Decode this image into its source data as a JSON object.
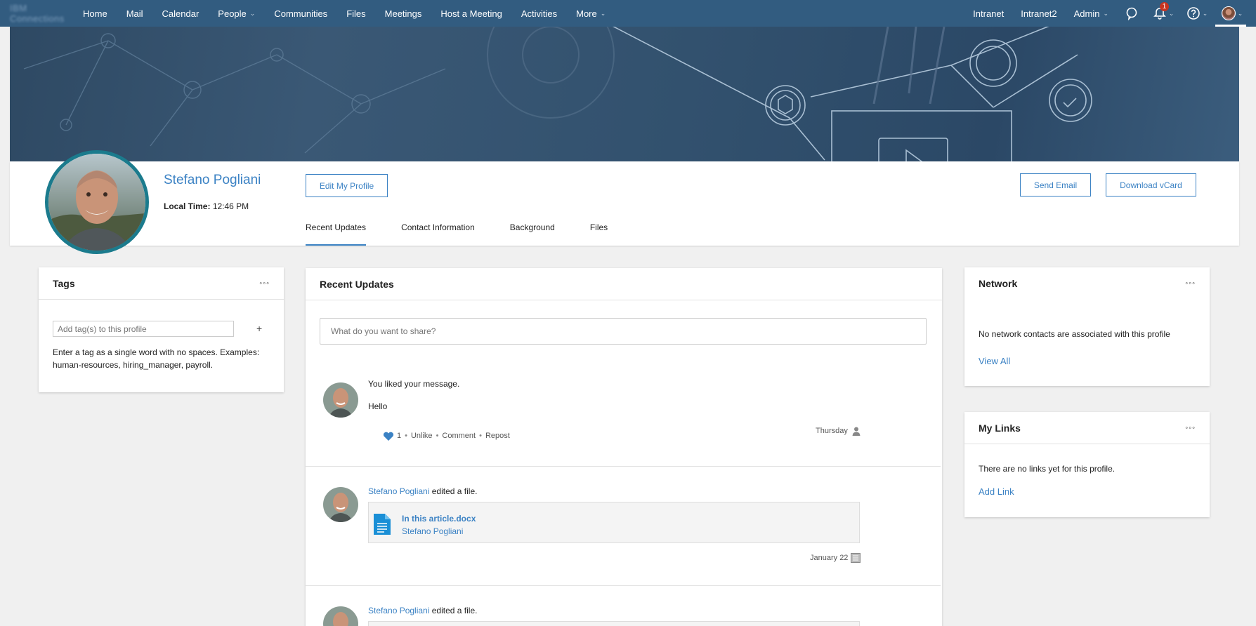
{
  "nav": {
    "brand": "IBM Connections",
    "items": [
      "Home",
      "Mail",
      "Calendar",
      "People",
      "Communities",
      "Files",
      "Meetings",
      "Host a Meeting",
      "Activities",
      "More"
    ],
    "right_items": [
      "Intranet",
      "Intranet2",
      "Admin"
    ],
    "notification_count": "1"
  },
  "profile": {
    "name": "Stefano Pogliani",
    "local_time_label": "Local Time:",
    "local_time": "12:46 PM",
    "edit_button": "Edit My Profile",
    "send_email": "Send Email",
    "download_vcard": "Download vCard",
    "tabs": [
      "Recent Updates",
      "Contact Information",
      "Background",
      "Files"
    ]
  },
  "tags_card": {
    "title": "Tags",
    "placeholder": "Add tag(s) to this profile",
    "add": "+",
    "help": "Enter a tag as a single word with no spaces. Examples: human-resources, hiring_manager, payroll."
  },
  "updates": {
    "title": "Recent Updates",
    "share_placeholder": "What do you want to share?",
    "entries": [
      {
        "text": "You liked your message.",
        "message": "Hello",
        "likes": "1",
        "actions": [
          "Unlike",
          "Comment",
          "Repost"
        ],
        "date": "Thursday"
      },
      {
        "author": "Stefano Pogliani",
        "action": "edited a file.",
        "file_name": "In this article.docx",
        "file_owner": "Stefano Pogliani",
        "date": "January 22"
      },
      {
        "author": "Stefano Pogliani",
        "action": "edited a file."
      }
    ]
  },
  "network_card": {
    "title": "Network",
    "message": "No network contacts are associated with this profile",
    "link": "View All"
  },
  "links_card": {
    "title": "My Links",
    "message": "There are no links yet for this profile.",
    "link": "Add Link"
  },
  "colors": {
    "nav_bg": "#325c80",
    "accent": "#3b82c4",
    "avatar_ring": "#1b7b8d",
    "badge": "#c8331f"
  }
}
